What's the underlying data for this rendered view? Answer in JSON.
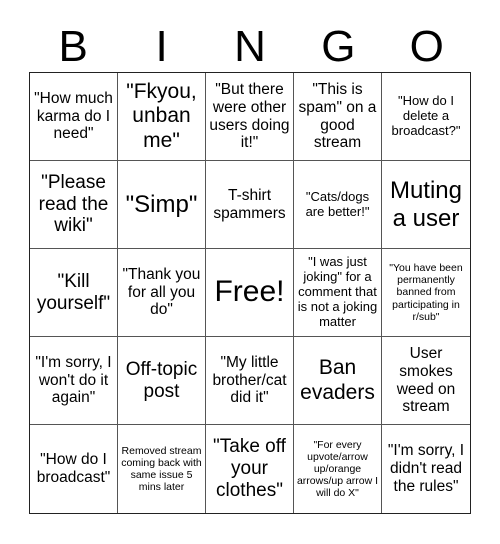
{
  "header": {
    "letters": [
      "B",
      "I",
      "N",
      "G",
      "O"
    ]
  },
  "cells": [
    "\"How much karma do I need\"",
    "\"Fkyou, unban me\"",
    "\"But there were other users doing it!\"",
    "\"This is spam\" on a good stream",
    "\"How do I delete a broadcast?\"",
    "\"Please read the wiki\"",
    "\"Simp\"",
    "T-shirt spammers",
    "\"Cats/dogs are better!\"",
    "Muting a user",
    "\"Kill yourself\"",
    "\"Thank you for all you do\"",
    "Free!",
    "\"I was just joking\" for a comment that is not a joking matter",
    "\"You have been permanently banned from participating in r/sub\"",
    "\"I'm sorry, I won't do it again\"",
    "Off-topic post",
    "\"My little brother/cat did it\"",
    "Ban evaders",
    "User smokes weed on stream",
    "\"How do I broadcast\"",
    "Removed stream coming back with same issue 5 mins later",
    "\"Take off your clothes\"",
    "\"For every upvote/arrow up/orange arrows/up arrow I will do X\"",
    "\"I'm sorry, I didn't read the rules\""
  ]
}
